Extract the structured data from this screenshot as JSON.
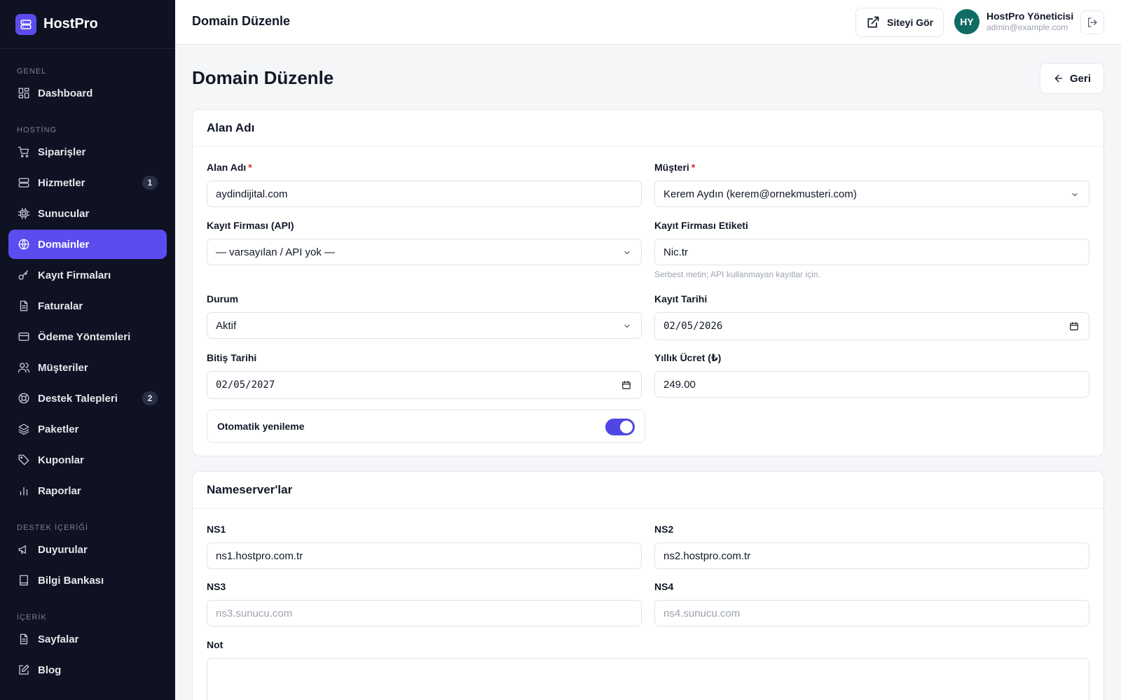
{
  "brand": {
    "name": "HostPro"
  },
  "sidebar": {
    "sections": {
      "general": "GENEL",
      "hosting": "HOSTİNG",
      "support_content": "DESTEK İÇERİĞİ",
      "content": "İÇERİK"
    },
    "items": {
      "dashboard": {
        "label": "Dashboard"
      },
      "orders": {
        "label": "Siparişler"
      },
      "services": {
        "label": "Hizmetler",
        "badge": "1"
      },
      "servers": {
        "label": "Sunucular"
      },
      "domains": {
        "label": "Domainler"
      },
      "registrars": {
        "label": "Kayıt Firmaları"
      },
      "invoices": {
        "label": "Faturalar"
      },
      "payment_methods": {
        "label": "Ödeme Yöntemleri"
      },
      "customers": {
        "label": "Müşteriler"
      },
      "tickets": {
        "label": "Destek Talepleri",
        "badge": "2"
      },
      "packages": {
        "label": "Paketler"
      },
      "coupons": {
        "label": "Kuponlar"
      },
      "reports": {
        "label": "Raporlar"
      },
      "announcements": {
        "label": "Duyurular"
      },
      "knowledge_base": {
        "label": "Bilgi Bankası"
      },
      "pages": {
        "label": "Sayfalar"
      },
      "blog": {
        "label": "Blog"
      }
    },
    "active": "domains",
    "accent_color": "#5b4cf0"
  },
  "topbar": {
    "title": "Domain Düzenle",
    "view_site_label": "Siteyi Gör",
    "user": {
      "initials": "HY",
      "name": "HostPro Yöneticisi",
      "email": "admin@example.com"
    }
  },
  "main": {
    "title": "Domain Düzenle",
    "back_label": "Geri"
  },
  "domain_card": {
    "title": "Alan Adı",
    "domain": {
      "label": "Alan Adı",
      "value": "aydindijital.com"
    },
    "customer": {
      "label": "Müşteri",
      "value": "Kerem Aydın (kerem@ornekmusteri.com)"
    },
    "registrar_api": {
      "label": "Kayıt Firması (API)",
      "value": "— varsayılan / API yok —"
    },
    "registrar_label": {
      "label": "Kayıt Firması Etiketi",
      "value": "Nic.tr",
      "help": "Serbest metin; API kullanmayan kayıtlar için."
    },
    "status": {
      "label": "Durum",
      "value": "Aktif"
    },
    "registration_date": {
      "label": "Kayıt Tarihi",
      "value": "02/05/2026"
    },
    "expiry_date": {
      "label": "Bitiş Tarihi",
      "value": "02/05/2027"
    },
    "annual_fee": {
      "label": "Yıllık Ücret (₺)",
      "value": "249.00"
    },
    "auto_renew": {
      "label": "Otomatik yenileme",
      "enabled": true
    }
  },
  "ns_card": {
    "title": "Nameserver'lar",
    "ns1": {
      "label": "NS1",
      "value": "ns1.hostpro.com.tr"
    },
    "ns2": {
      "label": "NS2",
      "value": "ns2.hostpro.com.tr"
    },
    "ns3": {
      "label": "NS3",
      "placeholder": "ns3.sunucu.com"
    },
    "ns4": {
      "label": "NS4",
      "placeholder": "ns4.sunucu.com"
    },
    "note": {
      "label": "Not"
    }
  }
}
